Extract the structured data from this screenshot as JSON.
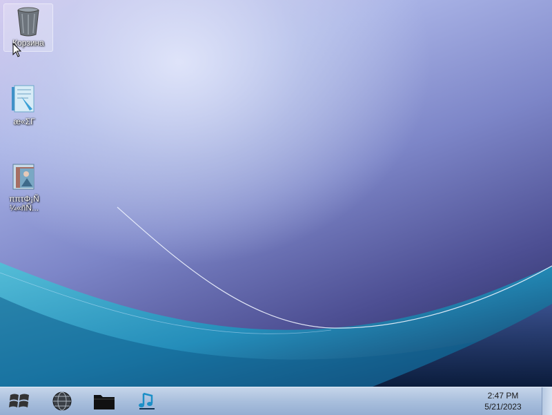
{
  "desktop": {
    "icons": [
      {
        "label": "Корзина",
        "icon": "recycle-bin-icon"
      },
      {
        "label": "æ«ΣΓ",
        "icon": "document-icon"
      },
      {
        "label": "ππτΦ¡Ñ ¼«ñÑ...",
        "icon": "photo-gallery-icon"
      }
    ]
  },
  "taskbar": {
    "start_icon": "windows-logo-icon",
    "pinned": [
      {
        "name": "browser",
        "icon": "globe-icon"
      },
      {
        "name": "file-explorer",
        "icon": "folder-icon"
      },
      {
        "name": "media-player",
        "icon": "music-note-icon"
      }
    ],
    "clock": {
      "time": "2:47 PM",
      "date": "5/21/2023"
    }
  },
  "colors": {
    "taskbar": "#a9bfdd",
    "desktop_top": "#d9c9ef",
    "desktop_bottom": "#1d2350",
    "wave_teal": "#22b5cf"
  }
}
